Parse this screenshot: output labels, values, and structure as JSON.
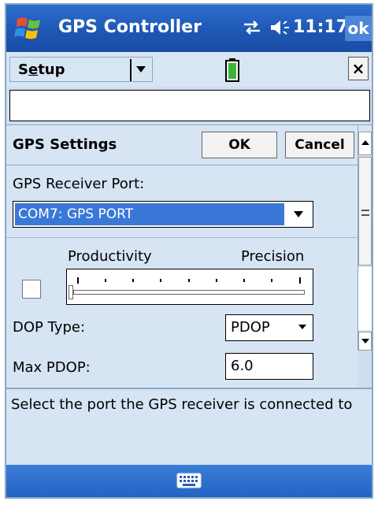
{
  "titlebar": {
    "app_title": "GPS Controller",
    "time": "11:17",
    "ok_label": "ok",
    "icons": [
      "windows-logo-icon",
      "connectivity-icon",
      "speaker-icon"
    ]
  },
  "menubar": {
    "setup_label": "Setup",
    "close_label": "×",
    "icons": [
      "battery-icon",
      "chevron-down-icon"
    ]
  },
  "settings": {
    "title": "GPS Settings",
    "ok_label": "OK",
    "cancel_label": "Cancel",
    "port_label": "GPS Receiver Port:",
    "port_value": "COM7: GPS PORT",
    "slider_left_label": "Productivity",
    "slider_right_label": "Precision",
    "slider_position": 0,
    "checkbox_checked": false,
    "dop_label": "DOP Type:",
    "dop_value": "PDOP",
    "max_label": "Max PDOP:",
    "max_value": "6.0"
  },
  "help": {
    "text": "Select the port the GPS receiver is connected to"
  },
  "taskbar": {
    "icons": [
      "keyboard-icon"
    ]
  },
  "colors": {
    "titlebar": "#1e57b4",
    "background": "#d6e4f3",
    "selection": "#3a78d8"
  }
}
